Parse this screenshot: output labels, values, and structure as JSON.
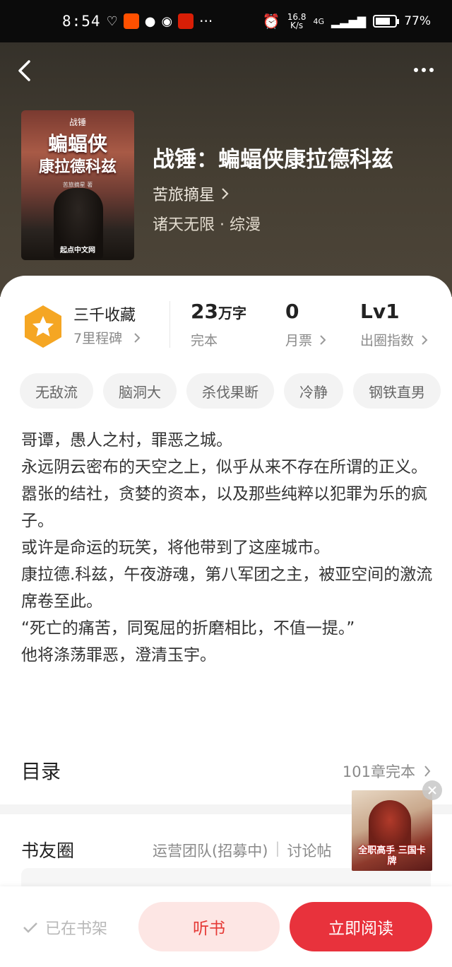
{
  "status_bar": {
    "time": "8:54",
    "net_speed_top": "16.8",
    "net_speed_bottom": "K/s",
    "network": "4G",
    "battery": "77%",
    "battery_level": 0.77
  },
  "book": {
    "title": "战锤：蝙蝠侠康拉德科兹",
    "author": "苦旅摘星",
    "genre": "诸天无限 · 综漫",
    "cover": {
      "top_text": "战锤",
      "title_line1": "蝙蝠侠",
      "title_line2": "康拉德科兹",
      "author": "苦旅摘星 著",
      "publisher": "起点中文网"
    }
  },
  "stats": {
    "collect_title": "三千收藏",
    "collect_sub": "7里程碑",
    "words_num": "23",
    "words_unit": "万字",
    "words_label": "完本",
    "tickets_num": "0",
    "tickets_label": "月票",
    "level_num": "Lv1",
    "level_label": "出圈指数"
  },
  "tags": [
    "无敌流",
    "脑洞大",
    "杀伐果断",
    "冷静",
    "钢铁直男"
  ],
  "description": [
    "哥谭，愚人之村，罪恶之城。",
    "永远阴云密布的天空之上，似乎从来不存在所谓的正义。",
    "嚣张的结社，贪婪的资本，以及那些纯粹以犯罪为乐的疯子。",
    "或许是命运的玩笑，将他带到了这座城市。",
    "康拉德.科兹，午夜游魂，第八军团之主，被亚空间的激流席卷至此。",
    "“死亡的痛苦，同冤屈的折磨相比，不值一提。”",
    "他将涤荡罪恶，澄清玉宇。"
  ],
  "toc": {
    "title": "目录",
    "summary": "101章完本"
  },
  "circle": {
    "title": "书友圈",
    "link1": "运营团队(招募中)",
    "divider": "|",
    "link2": "讨论帖"
  },
  "float_ad": {
    "text": "全职高手 三国卡牌"
  },
  "bottom": {
    "shelf_label": "已在书架",
    "listen_label": "听书",
    "read_label": "立即阅读"
  },
  "colors": {
    "accent_red": "#e8323c",
    "light_red": "#fde6e4",
    "badge_orange": "#f5a623"
  },
  "icons": {
    "back": "chevron-left-icon",
    "more": "more-dots-icon",
    "badge": "star-hexagon-icon",
    "check": "check-icon",
    "close": "close-icon"
  }
}
